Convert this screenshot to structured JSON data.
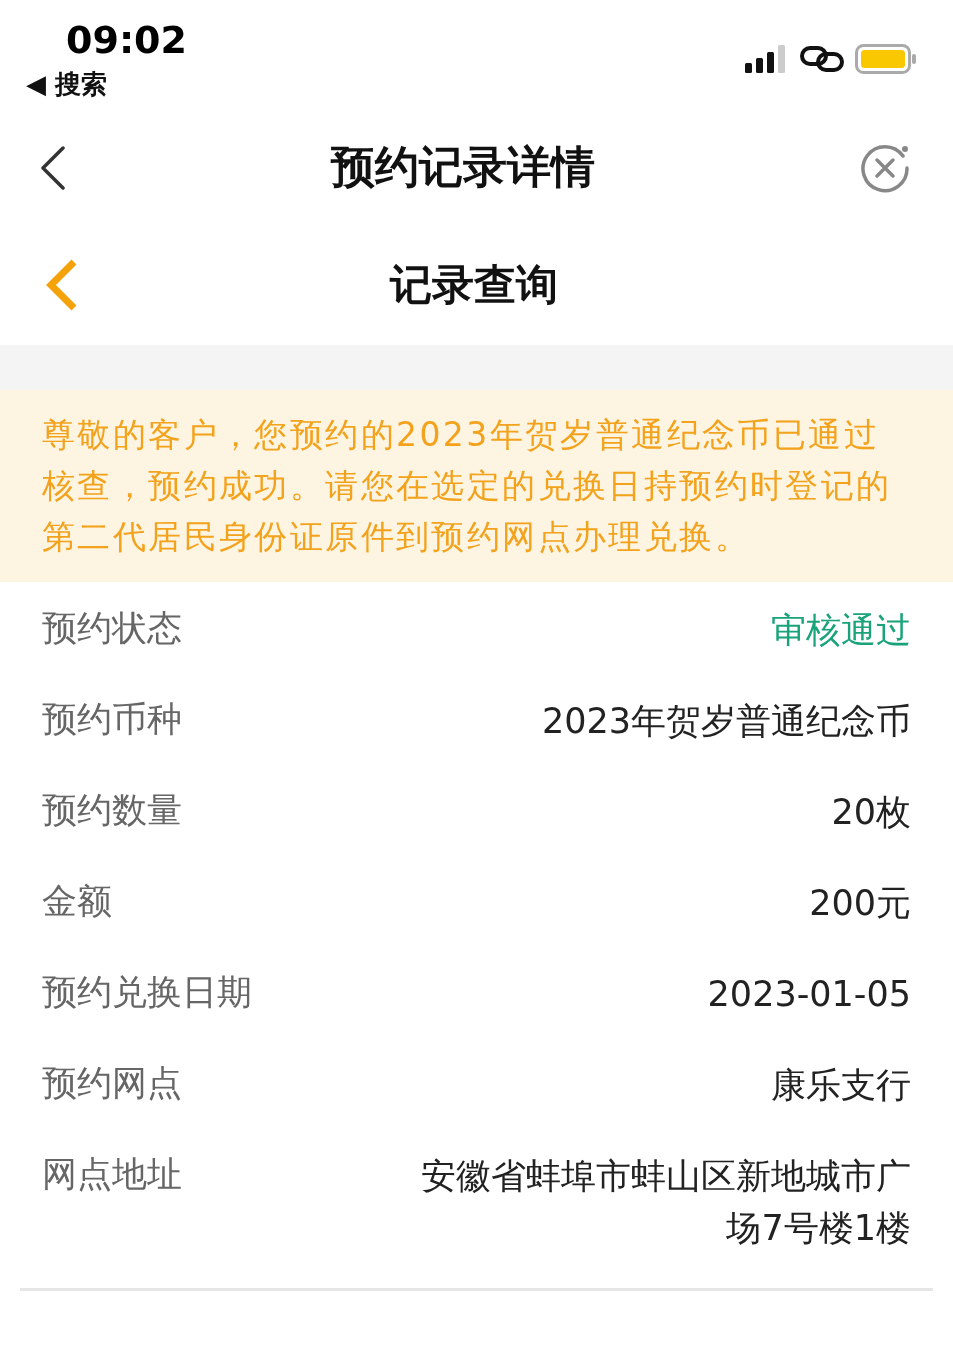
{
  "status_bar": {
    "time": "09:02",
    "back_app": "◀ 搜索"
  },
  "nav_bar": {
    "title": "预约记录详情"
  },
  "sub_header": {
    "title": "记录查询"
  },
  "notice": "尊敬的客户，您预约的2023年贺岁普通纪念币已通过核查，预约成功。请您在选定的兑换日持预约时登记的第二代居民身份证原件到预约网点办理兑换。",
  "details": [
    {
      "label": "预约状态",
      "value": "审核通过",
      "kind": "status"
    },
    {
      "label": "预约币种",
      "value": "2023年贺岁普通纪念币",
      "kind": "text"
    },
    {
      "label": "预约数量",
      "value": "20枚",
      "kind": "text"
    },
    {
      "label": "金额",
      "value": "200元",
      "kind": "text"
    },
    {
      "label": "预约兑换日期",
      "value": "2023-01-05",
      "kind": "text"
    },
    {
      "label": "预约网点",
      "value": "康乐支行",
      "kind": "text"
    },
    {
      "label": "网点地址",
      "value": "安徽省蚌埠市蚌山区新地城市广场7号楼1楼",
      "kind": "text"
    }
  ]
}
